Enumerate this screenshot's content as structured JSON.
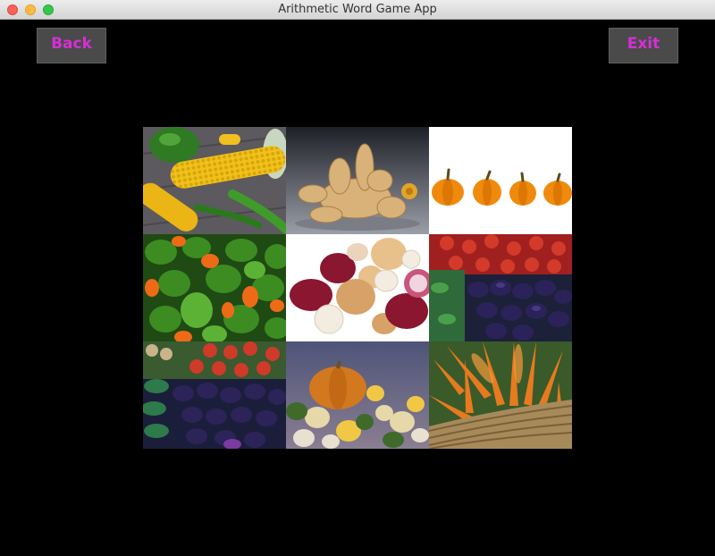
{
  "window": {
    "title": "Arithmetic Word Game App"
  },
  "buttons": {
    "back": "Back",
    "exit": "Exit",
    "color": "#d62fd6"
  },
  "tiles": [
    {
      "name": "corn-and-peppers"
    },
    {
      "name": "ginger-root"
    },
    {
      "name": "pumpkins-row"
    },
    {
      "name": "bell-peppers"
    },
    {
      "name": "onions-and-garlic"
    },
    {
      "name": "tomatoes-and-eggplants"
    },
    {
      "name": "eggplants-and-tomatoes"
    },
    {
      "name": "pumpkin-and-gourds"
    },
    {
      "name": "carrots-in-basket"
    }
  ]
}
